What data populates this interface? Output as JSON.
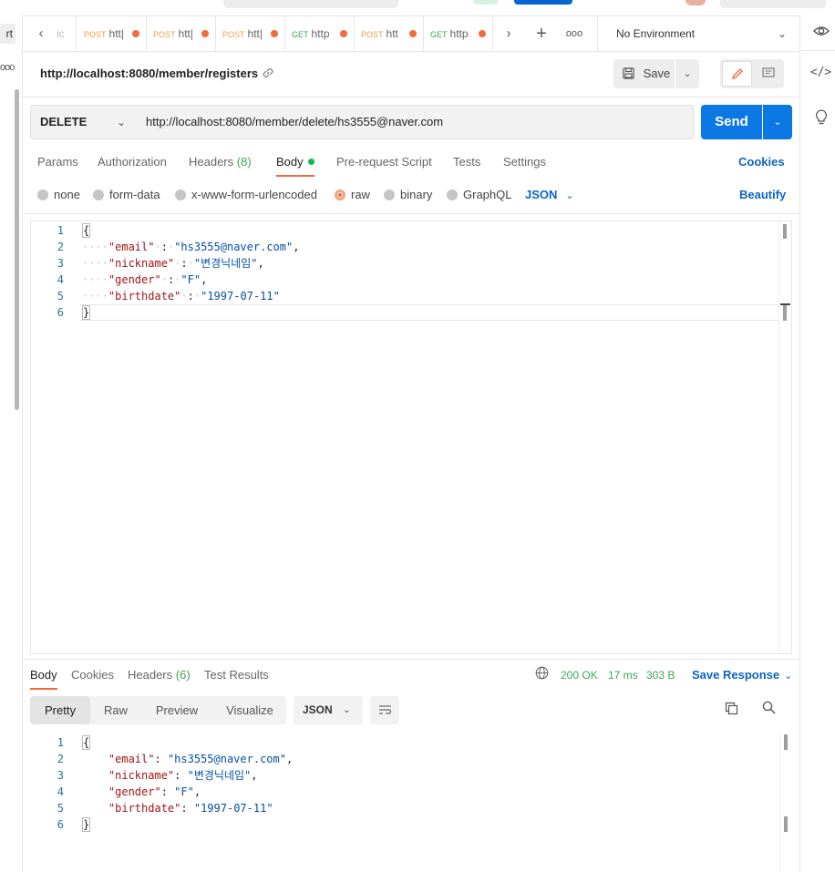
{
  "left_rail": {
    "tab_fragment": "rt",
    "dots": "ooo"
  },
  "tabs": {
    "first_fragment": "ic",
    "items": [
      {
        "method": "POST",
        "url": "htt|"
      },
      {
        "method": "POST",
        "url": "htt|"
      },
      {
        "method": "POST",
        "url": "htt|"
      },
      {
        "method": "GET",
        "url": "http"
      },
      {
        "method": "POST",
        "url": "htt"
      },
      {
        "method": "GET",
        "url": "http"
      }
    ],
    "more": "ooo",
    "environment": "No Environment"
  },
  "request": {
    "title": "http://localhost:8080/member/registers",
    "save_label": "Save",
    "method": "DELETE",
    "url": "http://localhost:8080/member/delete/hs3555@naver.com",
    "send_label": "Send",
    "tabs": [
      "Params",
      "Authorization",
      "Headers",
      "Body",
      "Pre-request Script",
      "Tests",
      "Settings"
    ],
    "headers_count": "(8)",
    "cookies_label": "Cookies",
    "body_types": [
      "none",
      "form-data",
      "x-www-form-urlencoded",
      "raw",
      "binary",
      "GraphQL"
    ],
    "body_format": "JSON",
    "beautify_label": "Beautify",
    "body_lines": [
      {
        "n": "1",
        "key": "",
        "val": "",
        "raw": "{"
      },
      {
        "n": "2",
        "key": "\"email\"",
        "val": "\"hs3555@naver.com\""
      },
      {
        "n": "3",
        "key": "\"nickname\"",
        "val": "\"변경닉네임\""
      },
      {
        "n": "4",
        "key": "\"gender\"",
        "val": "\"F\""
      },
      {
        "n": "5",
        "key": "\"birthdate\"",
        "val": "\"1997-07-11\""
      },
      {
        "n": "6",
        "key": "",
        "val": "",
        "raw": "}"
      }
    ]
  },
  "response": {
    "tabs": [
      "Body",
      "Cookies",
      "Headers",
      "Test Results"
    ],
    "headers_count": "(6)",
    "status": "200 OK",
    "time": "17 ms",
    "size": "303 B",
    "save_response_label": "Save Response",
    "formats": [
      "Pretty",
      "Raw",
      "Preview",
      "Visualize"
    ],
    "language": "JSON",
    "body_lines": [
      {
        "n": "1",
        "key": "",
        "val": "",
        "raw": "{"
      },
      {
        "n": "2",
        "key": "\"email\"",
        "val": "\"hs3555@naver.com\""
      },
      {
        "n": "3",
        "key": "\"nickname\"",
        "val": "\"변경닉네임\""
      },
      {
        "n": "4",
        "key": "\"gender\"",
        "val": "\"F\""
      },
      {
        "n": "5",
        "key": "\"birthdate\"",
        "val": "\"1997-07-11\""
      },
      {
        "n": "6",
        "key": "",
        "val": "",
        "raw": "}"
      }
    ]
  },
  "colors": {
    "accent": "#f26b3a",
    "send": "#0b78e3",
    "link": "#0b65c2",
    "status_ok": "#3ea45b"
  }
}
